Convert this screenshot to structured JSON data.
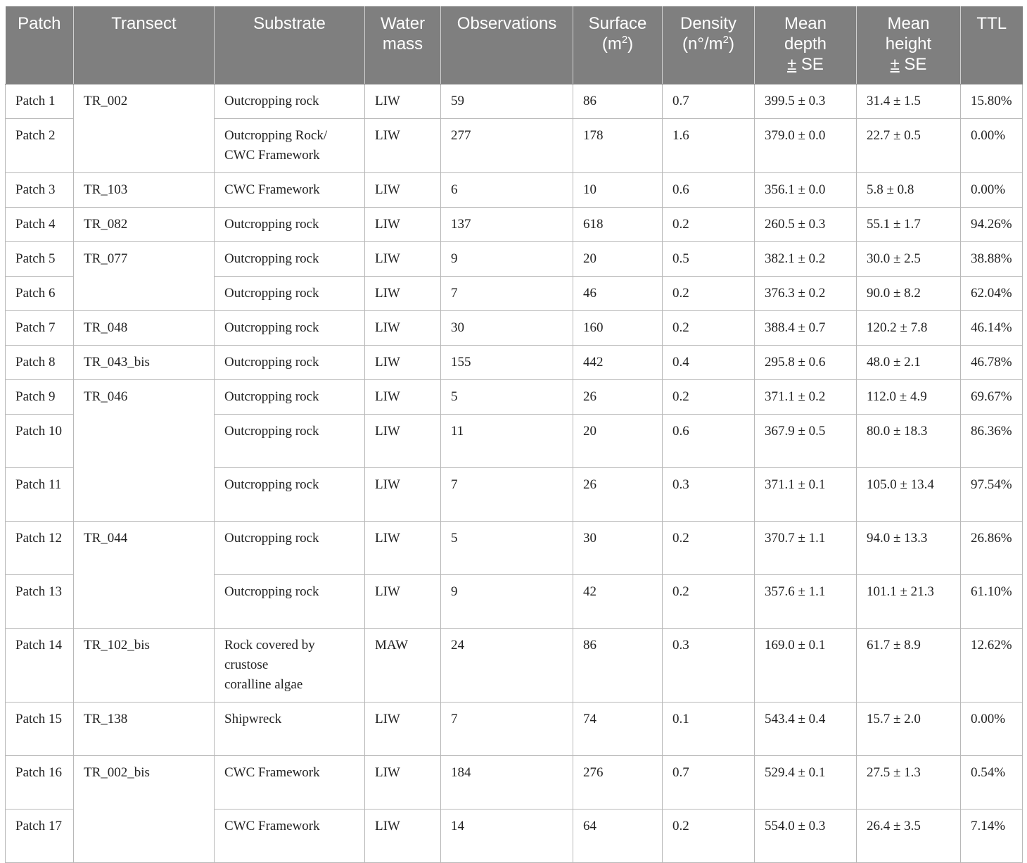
{
  "headers": {
    "patch": "Patch",
    "transect": "Transect",
    "substrate": "Substrate",
    "water_mass": "Water mass",
    "observations": "Observations",
    "surface": "Surface",
    "surface_unit_pre": "(m",
    "surface_unit_sup": "2",
    "surface_unit_post": ")",
    "density": "Density",
    "density_unit_pre": "(n°/m",
    "density_unit_sup": "2",
    "density_unit_post": ")",
    "mean_depth_1": "Mean",
    "mean_depth_2": "depth",
    "mean_depth_pm": "±",
    "mean_depth_se": "SE",
    "mean_height_1": "Mean",
    "mean_height_2": "height",
    "mean_height_pm": "±",
    "mean_height_se": "SE",
    "ttl": "TTL"
  },
  "transects": [
    "TR_002",
    "TR_103",
    "TR_082",
    "TR_077",
    "TR_048",
    "TR_043_bis",
    "TR_046",
    "TR_044",
    "TR_102_bis",
    "TR_138",
    "TR_002_bis"
  ],
  "rows": [
    {
      "patch": "Patch 1",
      "substrate": "Outcropping rock",
      "water": "LIW",
      "obs": "59",
      "surface": "86",
      "density": "0.7",
      "depth": "399.5 ± 0.3",
      "height": "31.4 ± 1.5",
      "ttl": "15.80%"
    },
    {
      "patch": "Patch 2",
      "substrate": "Outcropping Rock/ CWC Framework",
      "water": "LIW",
      "obs": "277",
      "surface": "178",
      "density": "1.6",
      "depth": "379.0 ± 0.0",
      "height": "22.7 ± 0.5",
      "ttl": "0.00%"
    },
    {
      "patch": "Patch 3",
      "substrate": "CWC Framework",
      "water": "LIW",
      "obs": "6",
      "surface": "10",
      "density": "0.6",
      "depth": "356.1 ± 0.0",
      "height": "5.8 ± 0.8",
      "ttl": "0.00%"
    },
    {
      "patch": "Patch 4",
      "substrate": "Outcropping rock",
      "water": "LIW",
      "obs": "137",
      "surface": "618",
      "density": "0.2",
      "depth": "260.5 ± 0.3",
      "height": "55.1 ± 1.7",
      "ttl": "94.26%"
    },
    {
      "patch": "Patch 5",
      "substrate": "Outcropping rock",
      "water": "LIW",
      "obs": "9",
      "surface": "20",
      "density": "0.5",
      "depth": "382.1 ± 0.2",
      "height": "30.0 ± 2.5",
      "ttl": "38.88%"
    },
    {
      "patch": "Patch 6",
      "substrate": "Outcropping rock",
      "water": "LIW",
      "obs": "7",
      "surface": "46",
      "density": "0.2",
      "depth": "376.3 ± 0.2",
      "height": "90.0 ± 8.2",
      "ttl": "62.04%"
    },
    {
      "patch": "Patch 7",
      "substrate": "Outcropping rock",
      "water": "LIW",
      "obs": "30",
      "surface": "160",
      "density": "0.2",
      "depth": "388.4 ± 0.7",
      "height": "120.2 ± 7.8",
      "ttl": "46.14%"
    },
    {
      "patch": "Patch 8",
      "substrate": "Outcropping rock",
      "water": "LIW",
      "obs": "155",
      "surface": "442",
      "density": "0.4",
      "depth": "295.8 ± 0.6",
      "height": "48.0 ± 2.1",
      "ttl": "46.78%"
    },
    {
      "patch": "Patch 9",
      "substrate": "Outcropping rock",
      "water": "LIW",
      "obs": "5",
      "surface": "26",
      "density": "0.2",
      "depth": "371.1 ± 0.2",
      "height": "112.0 ± 4.9",
      "ttl": "69.67%"
    },
    {
      "patch": "Patch 10",
      "substrate": "Outcropping rock",
      "water": "LIW",
      "obs": "11",
      "surface": "20",
      "density": "0.6",
      "depth": "367.9 ± 0.5",
      "height": "80.0 ± 18.3",
      "ttl": "86.36%"
    },
    {
      "patch": "Patch 11",
      "substrate": "Outcropping rock",
      "water": "LIW",
      "obs": "7",
      "surface": "26",
      "density": "0.3",
      "depth": "371.1 ± 0.1",
      "height": "105.0 ± 13.4",
      "ttl": "97.54%"
    },
    {
      "patch": "Patch 12",
      "substrate": "Outcropping rock",
      "water": "LIW",
      "obs": "5",
      "surface": "30",
      "density": "0.2",
      "depth": "370.7 ± 1.1",
      "height": "94.0 ± 13.3",
      "ttl": "26.86%"
    },
    {
      "patch": "Patch 13",
      "substrate": "Outcropping rock",
      "water": "LIW",
      "obs": "9",
      "surface": "42",
      "density": "0.2",
      "depth": "357.6 ± 1.1",
      "height": "101.1 ± 21.3",
      "ttl": "61.10%"
    },
    {
      "patch": "Patch 14",
      "substrate_1": "Rock covered by",
      "substrate_2": "crustose",
      "substrate_3": "coralline algae",
      "water": "MAW",
      "obs": "24",
      "surface": "86",
      "density": "0.3",
      "depth": "169.0 ± 0.1",
      "height": "61.7 ± 8.9",
      "ttl": "12.62%"
    },
    {
      "patch": "Patch 15",
      "substrate": "Shipwreck",
      "water": "LIW",
      "obs": "7",
      "surface": "74",
      "density": "0.1",
      "depth": "543.4 ± 0.4",
      "height": "15.7 ± 2.0",
      "ttl": "0.00%"
    },
    {
      "patch": "Patch 16",
      "substrate": "CWC Framework",
      "water": "LIW",
      "obs": "184",
      "surface": "276",
      "density": "0.7",
      "depth": "529.4 ± 0.1",
      "height": "27.5 ± 1.3",
      "ttl": "0.54%"
    },
    {
      "patch": "Patch 17",
      "substrate": "CWC Framework",
      "water": "LIW",
      "obs": "14",
      "surface": "64",
      "density": "0.2",
      "depth": "554.0 ± 0.3",
      "height": "26.4 ± 3.5",
      "ttl": "7.14%"
    }
  ]
}
